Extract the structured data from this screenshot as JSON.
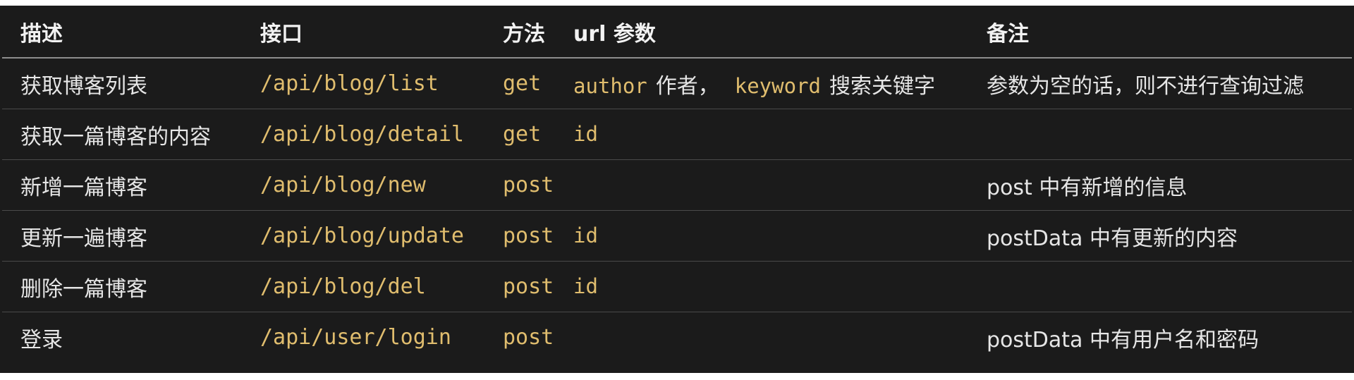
{
  "table": {
    "headers": {
      "description": "描述",
      "endpoint": "接口",
      "method": "方法",
      "params": "url 参数",
      "note": "备注"
    },
    "rows": [
      {
        "description": "获取博客列表",
        "endpoint": "/api/blog/list",
        "method": "get",
        "params": {
          "param1": "author",
          "param1_desc": "作者，",
          "param2": "keyword",
          "param2_desc": "搜索关键字"
        },
        "note": "参数为空的话，则不进行查询过滤"
      },
      {
        "description": "获取一篇博客的内容",
        "endpoint": "/api/blog/detail",
        "method": "get",
        "params": {
          "param1": "id"
        },
        "note": ""
      },
      {
        "description": "新增一篇博客",
        "endpoint": "/api/blog/new",
        "method": "post",
        "params": {},
        "note": "post 中有新增的信息"
      },
      {
        "description": "更新一遍博客",
        "endpoint": "/api/blog/update",
        "method": "post",
        "params": {
          "param1": "id"
        },
        "note": "postData 中有更新的内容"
      },
      {
        "description": "删除一篇博客",
        "endpoint": "/api/blog/del",
        "method": "post",
        "params": {
          "param1": "id"
        },
        "note": ""
      },
      {
        "description": "登录",
        "endpoint": "/api/user/login",
        "method": "post",
        "params": {},
        "note": "postData 中有用户名和密码"
      }
    ]
  },
  "colors": {
    "background": "#1b1b1b",
    "text": "#e6e6e6",
    "code": "#e0bd6e",
    "header_rule": "#8d8d8d",
    "row_rule": "#4a4a4a"
  }
}
